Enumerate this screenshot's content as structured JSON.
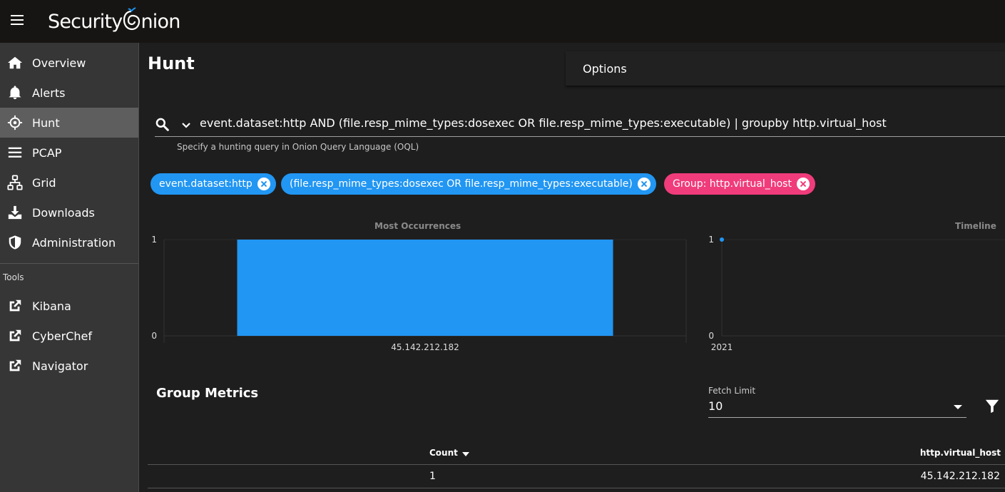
{
  "app": {
    "brand": "Security",
    "brand_suffix": "nion"
  },
  "sidebar": {
    "items": [
      {
        "label": "Overview",
        "icon": "home-icon"
      },
      {
        "label": "Alerts",
        "icon": "bell-icon"
      },
      {
        "label": "Hunt",
        "icon": "crosshairs-icon",
        "active": true
      },
      {
        "label": "PCAP",
        "icon": "list-icon"
      },
      {
        "label": "Grid",
        "icon": "sitemap-icon"
      },
      {
        "label": "Downloads",
        "icon": "download-icon"
      },
      {
        "label": "Administration",
        "icon": "shield-icon"
      }
    ],
    "tools_label": "Tools",
    "tools": [
      {
        "label": "Kibana",
        "icon": "external-link-icon"
      },
      {
        "label": "CyberChef",
        "icon": "external-link-icon"
      },
      {
        "label": "Navigator",
        "icon": "external-link-icon"
      }
    ]
  },
  "main": {
    "title": "Hunt",
    "options_label": "Options",
    "query": {
      "value": "event.dataset:http AND (file.resp_mime_types:dosexec OR file.resp_mime_types:executable) | groupby http.virtual_host",
      "hint": "Specify a hunting query in Onion Query Language (OQL)"
    },
    "chips": [
      {
        "label": "event.dataset:http",
        "color": "#2196f3"
      },
      {
        "label": "(file.resp_mime_types:dosexec OR file.resp_mime_types:executable)",
        "color": "#2196f3"
      },
      {
        "label": "Group: http.virtual_host",
        "color": "#f03c7b"
      }
    ],
    "group_metrics": {
      "title": "Group Metrics",
      "fetch_limit_label": "Fetch Limit",
      "fetch_limit_value": "10",
      "columns": {
        "count": "Count",
        "host": "http.virtual_host"
      },
      "rows": [
        {
          "count": "1",
          "host": "45.142.212.182"
        }
      ]
    }
  },
  "chart_data": [
    {
      "type": "bar",
      "title": "Most Occurrences",
      "categories": [
        "45.142.212.182"
      ],
      "values": [
        1
      ],
      "ylim": [
        0,
        1
      ],
      "yticks": [
        "0",
        "1"
      ],
      "color": "#2196f3"
    },
    {
      "type": "scatter",
      "title": "Timeline",
      "x": [
        "2021"
      ],
      "values": [
        1
      ],
      "ylim": [
        0,
        1
      ],
      "yticks": [
        "0",
        "1"
      ],
      "xticks": [
        "2021"
      ],
      "color": "#2196f3"
    }
  ]
}
